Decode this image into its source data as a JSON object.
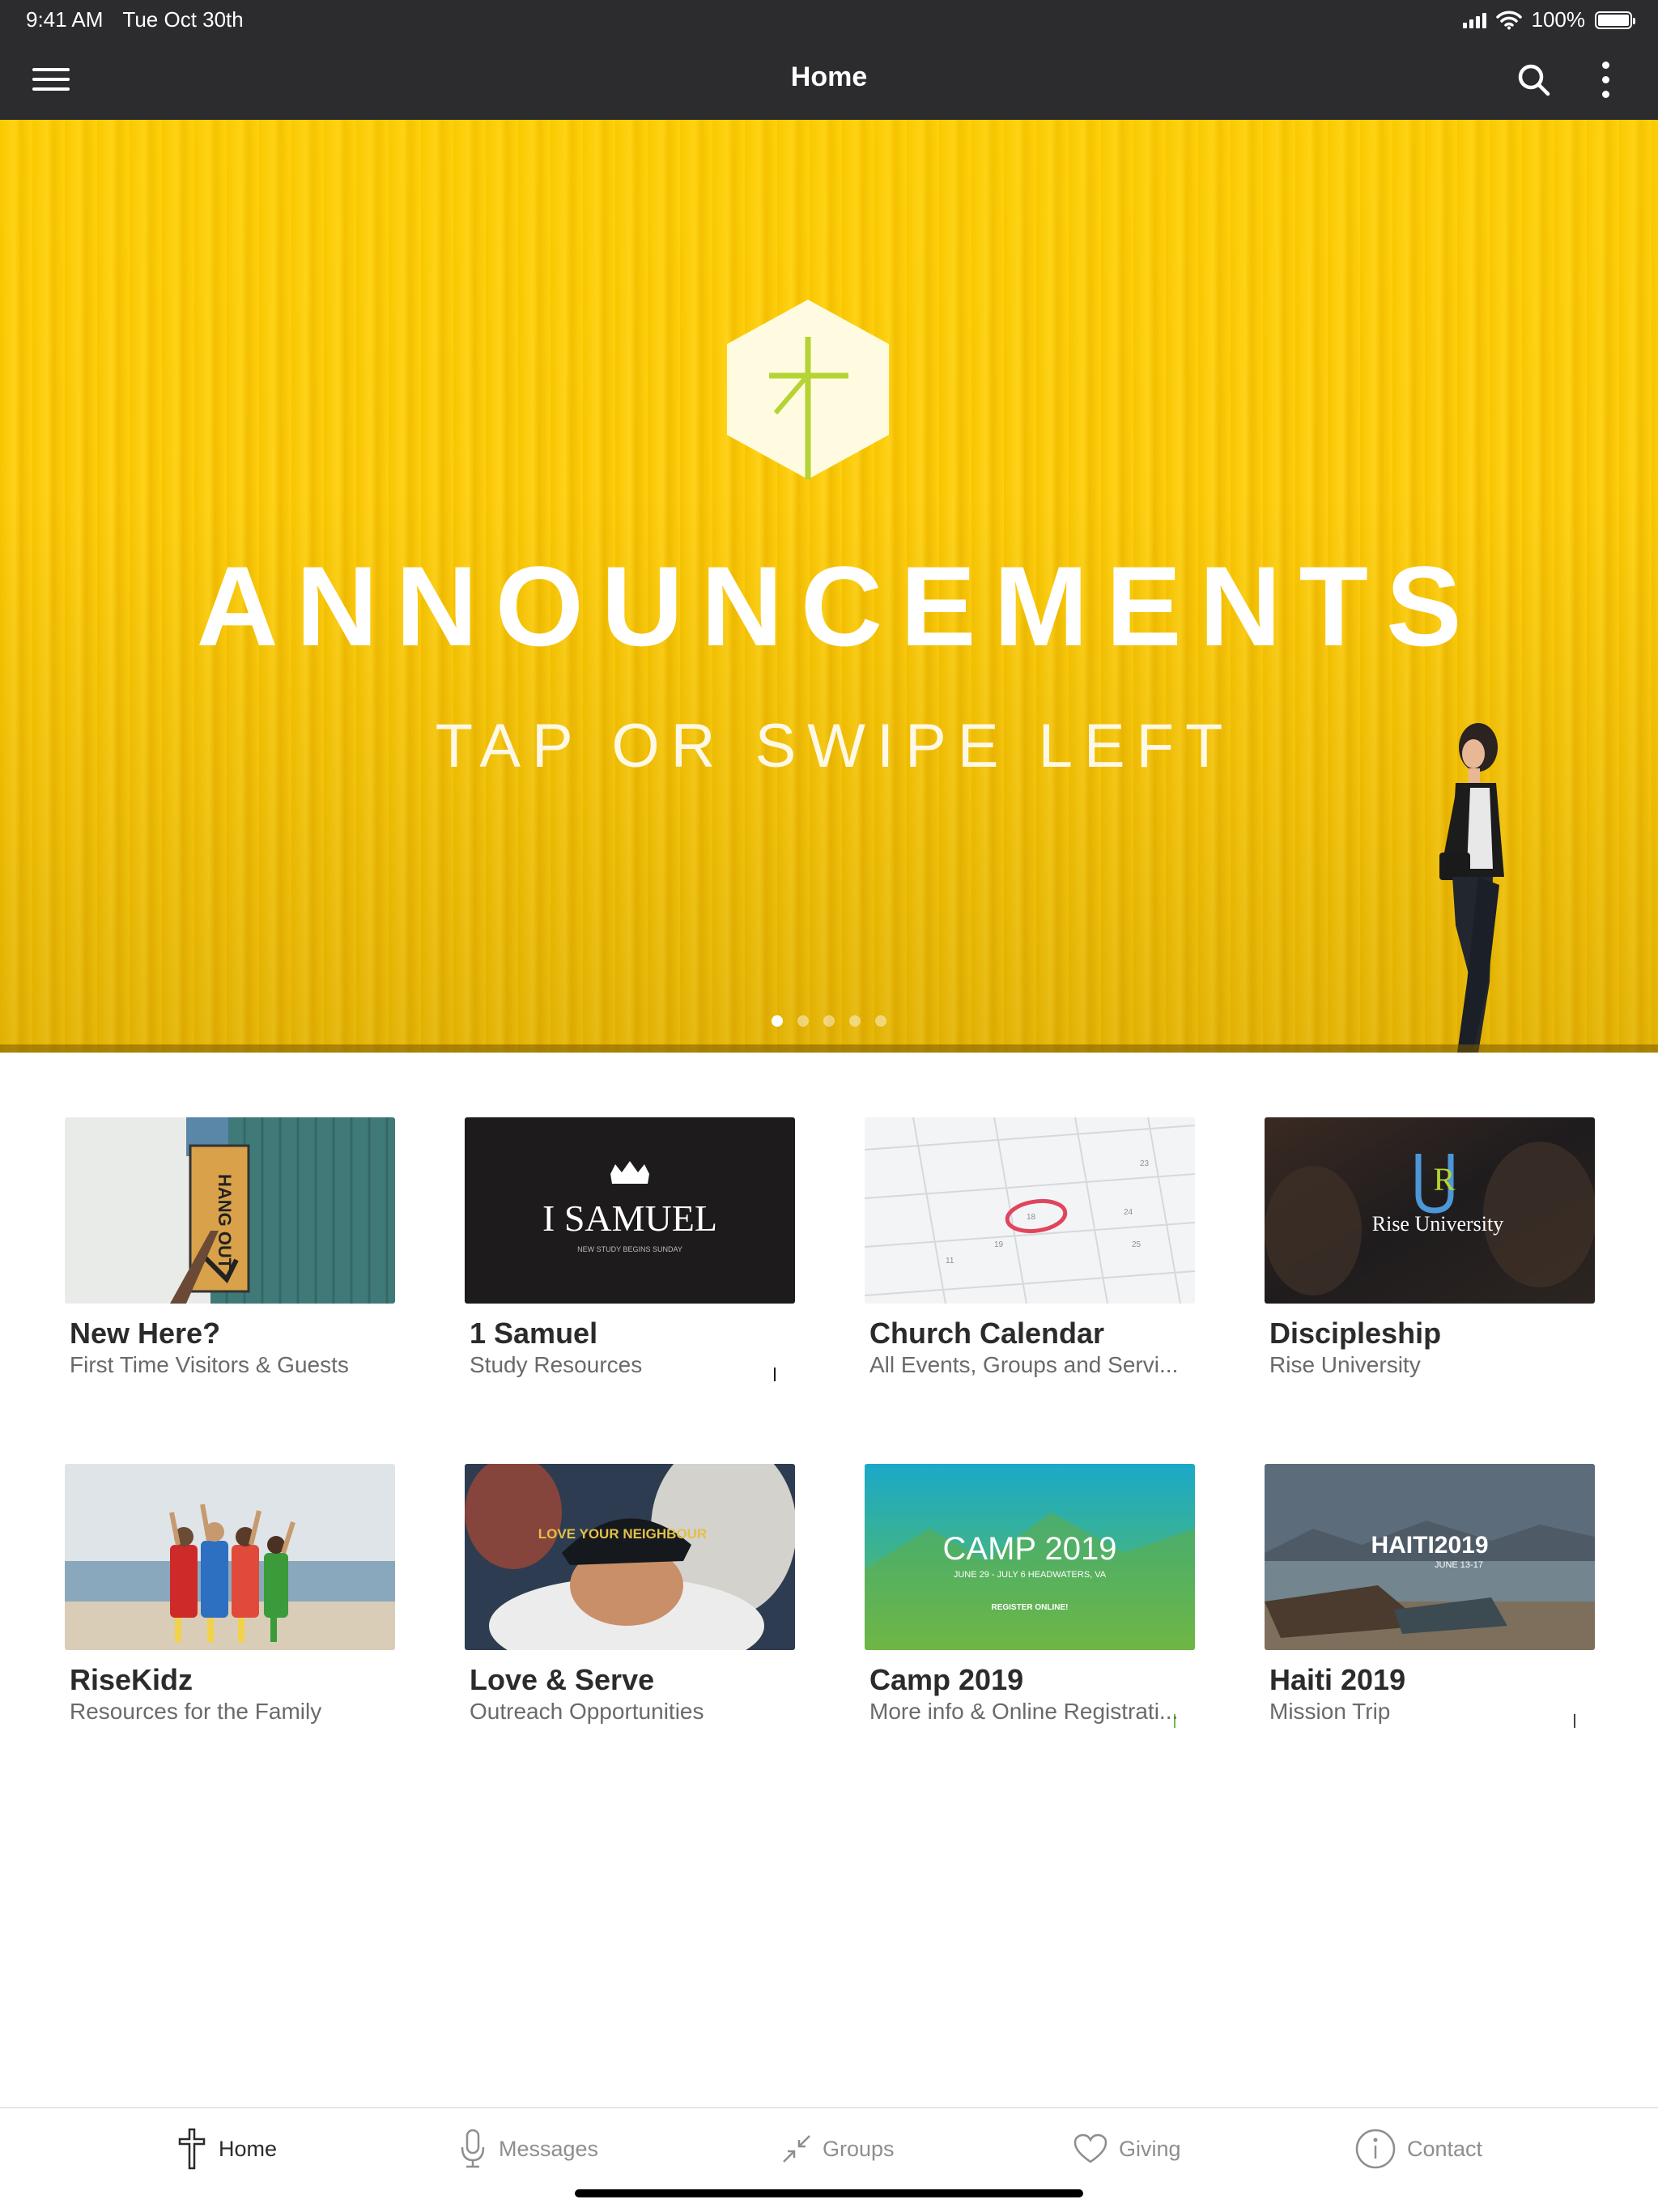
{
  "status_bar": {
    "time": "9:41 AM",
    "date": "Tue Oct 30th",
    "battery": "100%"
  },
  "nav": {
    "title": "Home"
  },
  "hero": {
    "title": "ANNOUNCEMENTS",
    "subtitle": "TAP OR SWIPE LEFT",
    "page_count": 5,
    "active_page": 1,
    "logo_icon": "cross-hexagon-icon"
  },
  "cards": [
    {
      "title": "New Here?",
      "subtitle": "First Time Visitors & Guests",
      "thumb_text": "COME HANG OUT"
    },
    {
      "title": "1 Samuel",
      "subtitle": "Study Resources",
      "thumb_text": "I SAMUEL",
      "thumb_small": "NEW STUDY BEGINS SUNDAY"
    },
    {
      "title": "Church Calendar",
      "subtitle": "All Events, Groups and Servi..."
    },
    {
      "title": "Discipleship",
      "subtitle": "Rise University",
      "thumb_text": "Rise University"
    },
    {
      "title": "RiseKidz",
      "subtitle": "Resources for the Family"
    },
    {
      "title": "Love & Serve",
      "subtitle": "Outreach Opportunities",
      "thumb_text": "LOVE YOUR NEIGHBOUR"
    },
    {
      "title": "Camp 2019",
      "subtitle": "More info & Online Registrati...",
      "thumb_text": "CAMP 2019",
      "thumb_small": "JUNE 29 - JULY 6 HEADWATERS, VA",
      "thumb_small2": "REGISTER ONLINE!"
    },
    {
      "title": "Haiti 2019",
      "subtitle": "Mission Trip",
      "thumb_text": "HAITI2019",
      "thumb_small": "JUNE 13-17"
    }
  ],
  "tabs": [
    {
      "label": "Home",
      "icon": "cross-icon",
      "active": true
    },
    {
      "label": "Messages",
      "icon": "microphone-icon",
      "active": false
    },
    {
      "label": "Groups",
      "icon": "arrows-inward-icon",
      "active": false
    },
    {
      "label": "Giving",
      "icon": "heart-icon",
      "active": false
    },
    {
      "label": "Contact",
      "icon": "info-icon",
      "active": false
    }
  ],
  "colors": {
    "bar": "#2c2c2e",
    "hero_yellow": "#ffcc00",
    "accent_green": "#b5d334"
  }
}
